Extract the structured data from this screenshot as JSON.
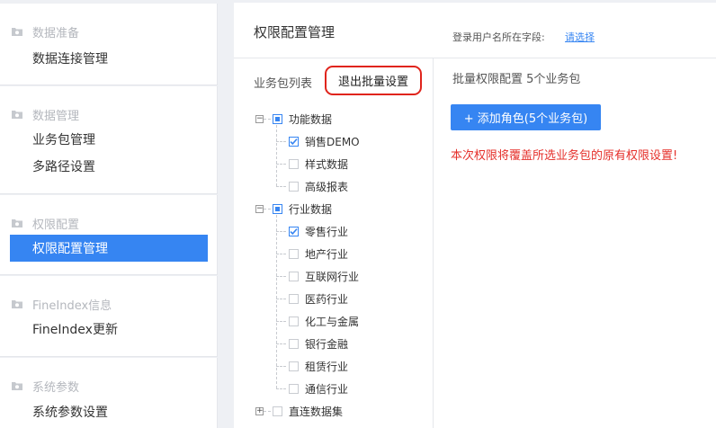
{
  "sidebar": {
    "groups": [
      {
        "title": "数据准备",
        "items": [
          {
            "label": "数据连接管理",
            "active": false
          }
        ]
      },
      {
        "title": "数据管理",
        "items": [
          {
            "label": "业务包管理",
            "active": false
          },
          {
            "label": "多路径设置",
            "active": false
          }
        ]
      },
      {
        "title": "权限配置",
        "items": [
          {
            "label": "权限配置管理",
            "active": true
          }
        ]
      },
      {
        "title": "FineIndex信息",
        "items": [
          {
            "label": "FineIndex更新",
            "active": false
          }
        ]
      },
      {
        "title": "系统参数",
        "items": [
          {
            "label": "系统参数设置",
            "active": false
          }
        ]
      }
    ],
    "group_icon": "folder-cloud-icon"
  },
  "main": {
    "title": "权限配置管理",
    "login_field_label": "登录用户名所在字段:",
    "login_field_link": "请选择"
  },
  "left_panel": {
    "label": "业务包列表",
    "exit_batch_label": "退出批量设置",
    "tree": [
      {
        "label": "功能数据",
        "state": "partial",
        "expanded": true,
        "children": [
          {
            "label": "销售DEMO",
            "checked": true
          },
          {
            "label": "样式数据",
            "checked": false
          },
          {
            "label": "高级报表",
            "checked": false
          }
        ]
      },
      {
        "label": "行业数据",
        "state": "partial",
        "expanded": true,
        "children": [
          {
            "label": "零售行业",
            "checked": true
          },
          {
            "label": "地产行业",
            "checked": false
          },
          {
            "label": "互联网行业",
            "checked": false
          },
          {
            "label": "医药行业",
            "checked": false
          },
          {
            "label": "化工与金属",
            "checked": false
          },
          {
            "label": "银行金融",
            "checked": false
          },
          {
            "label": "租赁行业",
            "checked": false
          },
          {
            "label": "通信行业",
            "checked": false
          }
        ]
      },
      {
        "label": "直连数据集",
        "state": "unchecked",
        "expanded": false,
        "children": []
      }
    ]
  },
  "right_panel": {
    "title": "批量权限配置 5个业务包",
    "add_role_label": "+ 添加角色(5个业务包)",
    "warning": "本次权限将覆盖所选业务包的原有权限设置!"
  },
  "colors": {
    "accent": "#3685f2",
    "warning": "#e5302b",
    "highlight_border": "#e0241c"
  }
}
